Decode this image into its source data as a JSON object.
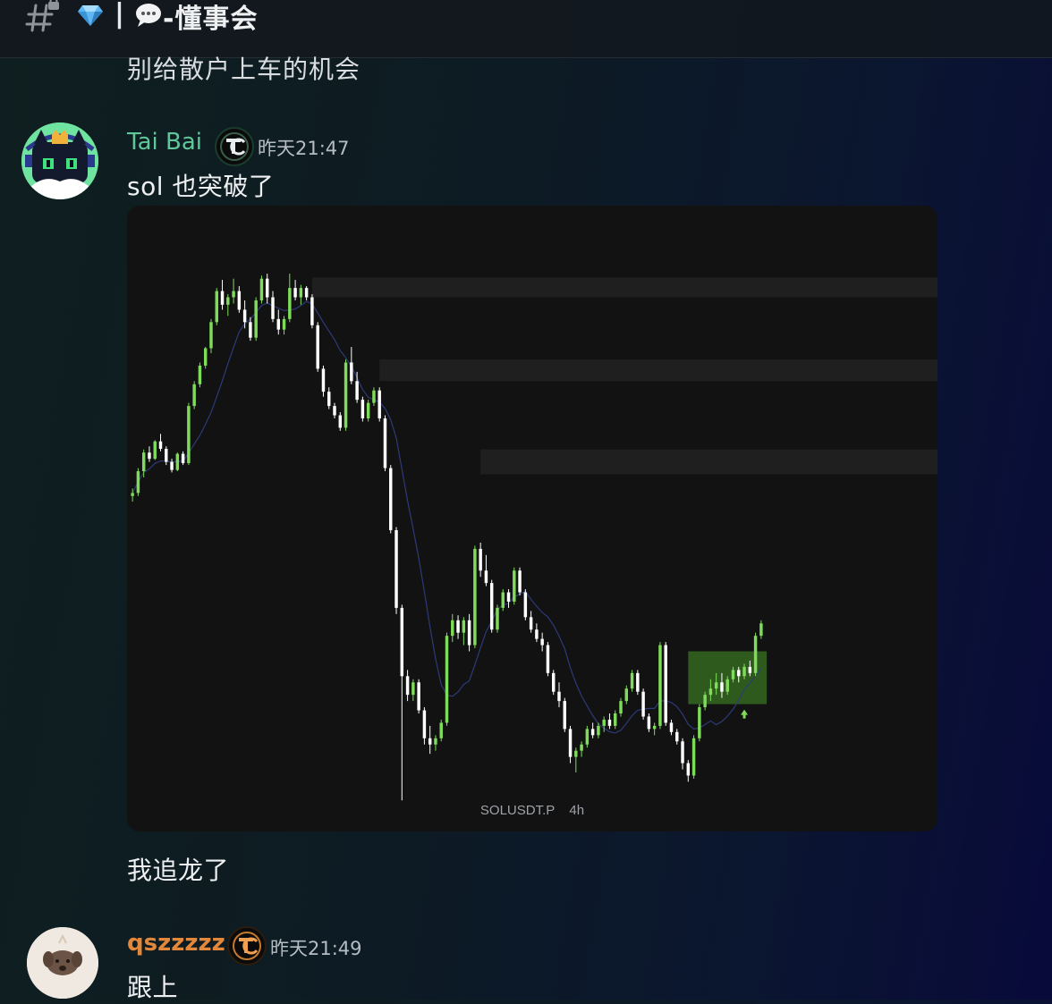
{
  "channel": {
    "separator": "|",
    "name": "-懂事会",
    "icons": [
      "hash-lock-icon",
      "gem-icon",
      "speech-bubble-icon"
    ]
  },
  "previous_message_text": "别给散户上车的机会",
  "messages": [
    {
      "author": "Tai Bai",
      "author_color": "#5fc79a",
      "badge_icon": "tc-badge-icon",
      "timestamp": "昨天21:47",
      "lines": [
        "sol 也突破了",
        "我追龙了"
      ],
      "attachment": {
        "type": "chart-image",
        "symbol": "SOLUSDT.P",
        "interval": "4h"
      }
    },
    {
      "author": "qszzzzz",
      "author_color": "#e3883a",
      "badge_icon": "tc-badge-icon",
      "timestamp": "昨天21:49",
      "lines": [
        "跟上"
      ]
    }
  ],
  "chart_data": {
    "type": "candlestick",
    "title": "",
    "symbol": "SOLUSDT.P",
    "interval": "4h",
    "up_color": "#7fdc5a",
    "down_color": "#ffffff",
    "ma_color": "#2d3a78",
    "zone_color": "#1f1f1f",
    "breakout_box_color": "#2f5a1e",
    "note": "OHLC values in relative price units (no price axis visible)",
    "candles": [
      [
        84.0,
        85.2,
        83.1,
        84.5
      ],
      [
        84.5,
        88.5,
        84.0,
        88.0
      ],
      [
        88.0,
        91.5,
        87.0,
        91.0
      ],
      [
        91.0,
        92.0,
        89.5,
        90.0
      ],
      [
        90.0,
        93.0,
        89.8,
        92.8
      ],
      [
        92.8,
        94.0,
        91.2,
        91.6
      ],
      [
        91.6,
        92.0,
        89.0,
        89.5
      ],
      [
        89.5,
        90.0,
        87.8,
        88.2
      ],
      [
        88.2,
        91.0,
        88.0,
        90.8
      ],
      [
        90.8,
        91.2,
        89.0,
        89.3
      ],
      [
        89.3,
        99.0,
        89.0,
        98.5
      ],
      [
        98.5,
        102.5,
        98.0,
        102.0
      ],
      [
        102.0,
        105.5,
        101.5,
        105.0
      ],
      [
        105.0,
        108.0,
        104.5,
        107.8
      ],
      [
        107.8,
        112.5,
        107.0,
        112.0
      ],
      [
        112.0,
        117.5,
        111.5,
        117.0
      ],
      [
        117.0,
        118.8,
        114.0,
        114.8
      ],
      [
        114.8,
        116.5,
        113.0,
        116.0
      ],
      [
        116.0,
        119.0,
        115.0,
        117.0
      ],
      [
        117.0,
        117.8,
        113.5,
        114.0
      ],
      [
        114.0,
        115.5,
        111.0,
        112.0
      ],
      [
        112.0,
        112.8,
        109.0,
        109.5
      ],
      [
        109.5,
        116.0,
        109.0,
        115.5
      ],
      [
        115.5,
        119.5,
        115.0,
        119.0
      ],
      [
        119.0,
        119.8,
        115.0,
        116.0
      ],
      [
        116.0,
        117.0,
        112.0,
        112.5
      ],
      [
        112.5,
        114.0,
        110.0,
        110.8
      ],
      [
        110.8,
        113.0,
        110.0,
        112.5
      ],
      [
        112.5,
        119.8,
        112.0,
        117.5
      ],
      [
        117.5,
        118.8,
        115.5,
        116.0
      ],
      [
        116.0,
        118.0,
        114.8,
        117.5
      ],
      [
        117.5,
        117.8,
        115.5,
        116.0
      ],
      [
        116.0,
        116.5,
        111.0,
        111.5
      ],
      [
        111.5,
        112.0,
        104.0,
        104.5
      ],
      [
        104.5,
        105.0,
        100.0,
        100.8
      ],
      [
        100.8,
        101.5,
        98.0,
        98.5
      ],
      [
        98.5,
        99.0,
        96.5,
        97.0
      ],
      [
        97.0,
        97.5,
        94.5,
        95.0
      ],
      [
        95.0,
        106.0,
        94.5,
        105.5
      ],
      [
        105.5,
        108.0,
        102.0,
        102.5
      ],
      [
        102.5,
        104.0,
        99.0,
        99.5
      ],
      [
        99.5,
        100.0,
        96.0,
        96.5
      ],
      [
        96.5,
        99.5,
        96.0,
        99.0
      ],
      [
        99.0,
        101.5,
        98.5,
        101.0
      ],
      [
        101.0,
        101.5,
        96.0,
        96.5
      ],
      [
        96.5,
        97.0,
        88.0,
        88.5
      ],
      [
        88.5,
        89.0,
        78.0,
        78.5
      ],
      [
        78.5,
        79.0,
        65.0,
        66.0
      ],
      [
        66.0,
        66.5,
        35.0,
        55.0
      ],
      [
        55.0,
        56.0,
        51.0,
        52.0
      ],
      [
        52.0,
        54.5,
        51.0,
        54.0
      ],
      [
        54.0,
        54.5,
        49.0,
        49.5
      ],
      [
        49.5,
        50.0,
        44.0,
        45.0
      ],
      [
        45.0,
        47.0,
        42.5,
        44.0
      ],
      [
        44.0,
        45.5,
        43.0,
        45.0
      ],
      [
        45.0,
        48.0,
        44.5,
        47.5
      ],
      [
        47.5,
        62.0,
        47.0,
        61.5
      ],
      [
        61.5,
        65.0,
        60.5,
        64.0
      ],
      [
        64.0,
        64.8,
        61.0,
        62.0
      ],
      [
        62.0,
        64.5,
        60.0,
        64.0
      ],
      [
        64.0,
        65.0,
        59.0,
        60.0
      ],
      [
        60.0,
        76.0,
        59.5,
        75.5
      ],
      [
        75.5,
        76.5,
        71.0,
        72.0
      ],
      [
        72.0,
        74.5,
        69.5,
        70.0
      ],
      [
        70.0,
        70.5,
        62.0,
        62.5
      ],
      [
        62.5,
        66.5,
        62.0,
        66.0
      ],
      [
        66.0,
        69.0,
        65.5,
        68.5
      ],
      [
        68.5,
        69.0,
        66.0,
        67.0
      ],
      [
        67.0,
        72.5,
        66.5,
        72.0
      ],
      [
        72.0,
        72.5,
        68.0,
        68.5
      ],
      [
        68.5,
        69.0,
        64.0,
        64.5
      ],
      [
        64.5,
        65.5,
        62.0,
        62.5
      ],
      [
        62.5,
        63.5,
        60.5,
        61.0
      ],
      [
        61.0,
        62.0,
        59.0,
        60.0
      ],
      [
        60.0,
        60.5,
        55.0,
        55.5
      ],
      [
        55.5,
        56.0,
        52.0,
        52.5
      ],
      [
        52.5,
        54.0,
        50.0,
        51.0
      ],
      [
        51.0,
        51.5,
        46.0,
        46.5
      ],
      [
        46.5,
        47.0,
        41.0,
        42.0
      ],
      [
        42.0,
        43.5,
        39.5,
        43.0
      ],
      [
        43.0,
        44.5,
        42.0,
        44.0
      ],
      [
        44.0,
        47.0,
        43.5,
        46.5
      ],
      [
        46.5,
        47.5,
        45.0,
        45.5
      ],
      [
        45.5,
        47.5,
        45.0,
        47.0
      ],
      [
        47.0,
        48.5,
        46.0,
        48.0
      ],
      [
        48.0,
        49.0,
        46.5,
        47.0
      ],
      [
        47.0,
        49.5,
        46.5,
        49.0
      ],
      [
        49.0,
        51.5,
        48.5,
        51.0
      ],
      [
        51.0,
        53.5,
        50.5,
        53.0
      ],
      [
        53.0,
        56.0,
        52.5,
        55.5
      ],
      [
        55.5,
        56.0,
        52.0,
        52.5
      ],
      [
        52.5,
        53.0,
        48.0,
        48.5
      ],
      [
        48.5,
        49.0,
        46.0,
        46.5
      ],
      [
        46.5,
        47.5,
        45.5,
        47.0
      ],
      [
        47.0,
        60.5,
        46.5,
        60.0
      ],
      [
        60.0,
        60.5,
        47.0,
        47.5
      ],
      [
        47.5,
        48.0,
        45.5,
        46.0
      ],
      [
        46.0,
        46.5,
        44.0,
        44.5
      ],
      [
        44.5,
        45.0,
        40.0,
        41.0
      ],
      [
        41.0,
        41.5,
        38.0,
        39.0
      ],
      [
        39.0,
        45.5,
        38.5,
        45.0
      ],
      [
        45.0,
        50.5,
        44.5,
        50.0
      ],
      [
        50.0,
        52.5,
        49.5,
        52.0
      ],
      [
        52.0,
        54.5,
        51.0,
        53.0
      ],
      [
        53.0,
        55.5,
        52.0,
        54.0
      ],
      [
        54.0,
        55.5,
        51.5,
        52.5
      ],
      [
        52.5,
        55.0,
        52.0,
        54.5
      ],
      [
        54.5,
        56.5,
        54.0,
        56.0
      ],
      [
        56.0,
        56.5,
        54.0,
        55.0
      ],
      [
        55.0,
        57.0,
        54.5,
        56.5
      ],
      [
        56.5,
        57.5,
        55.0,
        55.5
      ],
      [
        55.5,
        62.0,
        55.0,
        61.5
      ],
      [
        61.5,
        64.0,
        61.0,
        63.5
      ]
    ],
    "resistance_zones_relative": [
      [
        116.0,
        119.2
      ],
      [
        102.5,
        106.0
      ],
      [
        87.5,
        91.5
      ]
    ],
    "breakout_box": {
      "from_candle": 100,
      "to_candle": 112,
      "low": 50.5,
      "high": 59.0
    },
    "breakout_arrow_candle": 109
  }
}
